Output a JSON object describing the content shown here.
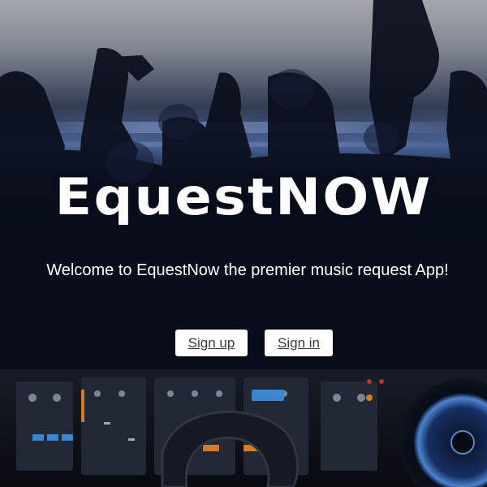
{
  "hero": {
    "logo_text": "EquestNOW",
    "tagline": "Welcome to EquestNow the premier music request App!"
  },
  "actions": {
    "signup_label": "Sign up",
    "signin_label": "Sign in"
  },
  "colors": {
    "text": "#ffffff",
    "button_bg": "#ffffff",
    "button_text": "#3a3a3a",
    "backdrop_dark": "#05070f",
    "stage_glow": "#4a6fb5"
  }
}
